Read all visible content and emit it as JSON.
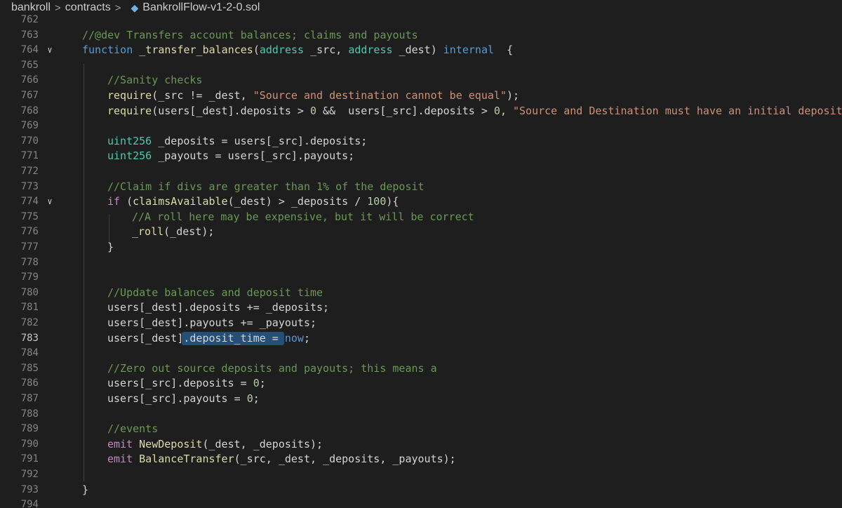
{
  "breadcrumb": {
    "items": [
      "bankroll",
      "contracts"
    ],
    "separator": ">",
    "file_icon": "solidity-diamond-icon",
    "file_name": "BankrollFlow-v1-2-0.sol"
  },
  "editor": {
    "current_line": 783,
    "selection": {
      "line": 783,
      "text": ".deposit_time = "
    },
    "lines": [
      {
        "n": 762,
        "indent": 0,
        "tokens": []
      },
      {
        "n": 763,
        "indent": 1,
        "tokens": [
          [
            "comment",
            "//@dev Transfers account balances; claims and payouts"
          ]
        ]
      },
      {
        "n": 764,
        "indent": 1,
        "fold": true,
        "tokens": [
          [
            "keyword",
            "function"
          ],
          [
            "text",
            " "
          ],
          [
            "func",
            "_transfer_balances"
          ],
          [
            "text",
            "("
          ],
          [
            "type",
            "address"
          ],
          [
            "text",
            " _src, "
          ],
          [
            "type",
            "address"
          ],
          [
            "text",
            " _dest) "
          ],
          [
            "keyword",
            "internal"
          ],
          [
            "text",
            "  {"
          ]
        ]
      },
      {
        "n": 765,
        "indent": 0,
        "tokens": []
      },
      {
        "n": 766,
        "indent": 2,
        "tokens": [
          [
            "comment",
            "//Sanity checks"
          ]
        ]
      },
      {
        "n": 767,
        "indent": 2,
        "tokens": [
          [
            "func",
            "require"
          ],
          [
            "text",
            "(_src != _dest, "
          ],
          [
            "string",
            "\"Source and destination cannot be equal\""
          ],
          [
            "text",
            ");"
          ]
        ]
      },
      {
        "n": 768,
        "indent": 2,
        "tokens": [
          [
            "func",
            "require"
          ],
          [
            "text",
            "(users[_dest].deposits > "
          ],
          [
            "number",
            "0"
          ],
          [
            "text",
            " &&  users[_src].deposits > "
          ],
          [
            "number",
            "0"
          ],
          [
            "text",
            ", "
          ],
          [
            "string",
            "\"Source and Destination must have an initial deposit\""
          ],
          [
            "text",
            ");"
          ]
        ]
      },
      {
        "n": 769,
        "indent": 0,
        "tokens": []
      },
      {
        "n": 770,
        "indent": 2,
        "tokens": [
          [
            "type",
            "uint256"
          ],
          [
            "text",
            " _deposits = users[_src].deposits;"
          ]
        ]
      },
      {
        "n": 771,
        "indent": 2,
        "tokens": [
          [
            "type",
            "uint256"
          ],
          [
            "text",
            " _payouts = users[_src].payouts;"
          ]
        ]
      },
      {
        "n": 772,
        "indent": 0,
        "tokens": []
      },
      {
        "n": 773,
        "indent": 2,
        "tokens": [
          [
            "comment",
            "//Claim if divs are greater than 1% of the deposit"
          ]
        ]
      },
      {
        "n": 774,
        "indent": 2,
        "fold": true,
        "tokens": [
          [
            "control",
            "if"
          ],
          [
            "text",
            " ("
          ],
          [
            "func",
            "claimsAvailable"
          ],
          [
            "text",
            "(_dest) > _deposits / "
          ],
          [
            "number",
            "100"
          ],
          [
            "text",
            "){"
          ]
        ]
      },
      {
        "n": 775,
        "indent": 3,
        "tokens": [
          [
            "comment",
            "//A roll here may be expensive, but it will be correct"
          ]
        ]
      },
      {
        "n": 776,
        "indent": 3,
        "tokens": [
          [
            "func",
            "_roll"
          ],
          [
            "text",
            "(_dest);"
          ]
        ]
      },
      {
        "n": 777,
        "indent": 2,
        "tokens": [
          [
            "text",
            "}"
          ]
        ]
      },
      {
        "n": 778,
        "indent": 0,
        "tokens": []
      },
      {
        "n": 779,
        "indent": 0,
        "tokens": []
      },
      {
        "n": 780,
        "indent": 2,
        "tokens": [
          [
            "comment",
            "//Update balances and deposit time"
          ]
        ]
      },
      {
        "n": 781,
        "indent": 2,
        "tokens": [
          [
            "text",
            "users[_dest].deposits += _deposits;"
          ]
        ]
      },
      {
        "n": 782,
        "indent": 2,
        "tokens": [
          [
            "text",
            "users[_dest].payouts += _payouts;"
          ]
        ]
      },
      {
        "n": 783,
        "indent": 2,
        "tokens": [
          [
            "text",
            "users[_dest]"
          ],
          [
            "text",
            ".deposit_time = "
          ],
          [
            "keyword",
            "now"
          ],
          [
            "text",
            ";"
          ]
        ]
      },
      {
        "n": 784,
        "indent": 0,
        "tokens": []
      },
      {
        "n": 785,
        "indent": 2,
        "tokens": [
          [
            "comment",
            "//Zero out source deposits and payouts; this means a"
          ]
        ]
      },
      {
        "n": 786,
        "indent": 2,
        "tokens": [
          [
            "text",
            "users[_src].deposits = "
          ],
          [
            "number",
            "0"
          ],
          [
            "text",
            ";"
          ]
        ]
      },
      {
        "n": 787,
        "indent": 2,
        "tokens": [
          [
            "text",
            "users[_src].payouts = "
          ],
          [
            "number",
            "0"
          ],
          [
            "text",
            ";"
          ]
        ]
      },
      {
        "n": 788,
        "indent": 0,
        "tokens": []
      },
      {
        "n": 789,
        "indent": 2,
        "tokens": [
          [
            "comment",
            "//events"
          ]
        ]
      },
      {
        "n": 790,
        "indent": 2,
        "tokens": [
          [
            "control",
            "emit"
          ],
          [
            "text",
            " "
          ],
          [
            "func",
            "NewDeposit"
          ],
          [
            "text",
            "(_dest, _deposits);"
          ]
        ]
      },
      {
        "n": 791,
        "indent": 2,
        "tokens": [
          [
            "control",
            "emit"
          ],
          [
            "text",
            " "
          ],
          [
            "func",
            "BalanceTransfer"
          ],
          [
            "text",
            "(_src, _dest, _deposits, _payouts);"
          ]
        ]
      },
      {
        "n": 792,
        "indent": 0,
        "tokens": []
      },
      {
        "n": 793,
        "indent": 1,
        "tokens": [
          [
            "text",
            "}"
          ]
        ]
      },
      {
        "n": 794,
        "indent": 0,
        "tokens": []
      }
    ]
  },
  "colors": {
    "background": "#1e1e1e",
    "comment": "#6a9955",
    "keyword": "#569cd6",
    "control": "#c586c0",
    "function": "#dcdcaa",
    "type": "#4ec9b0",
    "string": "#ce9178",
    "number": "#b5cea8",
    "selection": "#264f78"
  }
}
